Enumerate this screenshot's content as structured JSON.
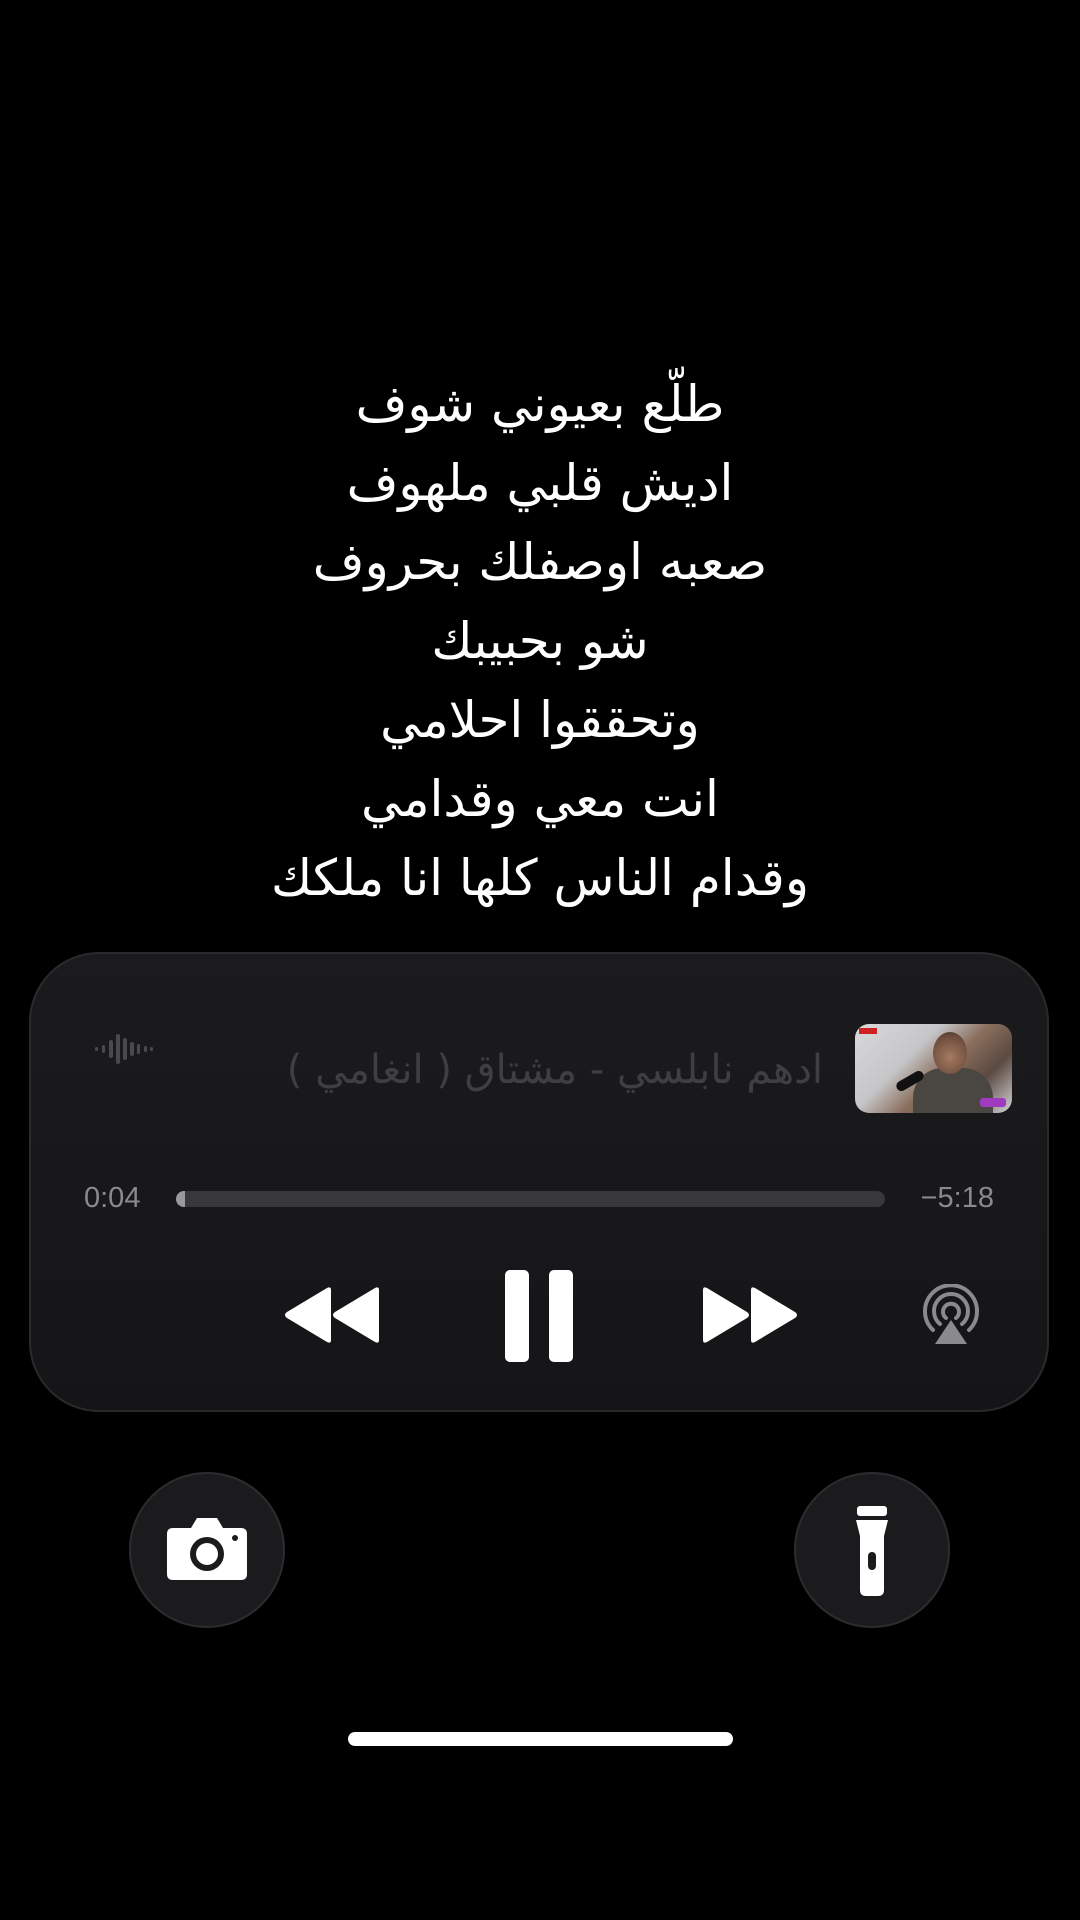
{
  "lyrics": {
    "lines": [
      "طلّع بعيوني شوف",
      "اديش قلبي ملهوف",
      "صعبه اوصفلك بحروف",
      "شو بحبيبك",
      "وتحققوا احلامي",
      "انت معي وقدامي",
      "وقدام الناس كلها انا ملكك"
    ]
  },
  "now_playing": {
    "title": "ادهم نابلسي - مشتاق ( انغامي )",
    "artwork_icon": "album-artwork",
    "waveform_icon": "waveform-icon",
    "elapsed": "0:04",
    "remaining": "−5:18",
    "progress_fraction": 0.013,
    "controls": {
      "rewind_icon": "rewind-icon",
      "pause_icon": "pause-icon",
      "forward_icon": "fast-forward-icon",
      "airplay_icon": "airplay-icon"
    }
  },
  "quick_actions": {
    "left_icon": "camera-icon",
    "right_icon": "flashlight-icon"
  },
  "colors": {
    "background": "#000000",
    "player_bg": "#1b1b1d",
    "text_primary": "#ffffff",
    "text_dim": "#3f3f42",
    "time_text": "#8a8a8e"
  }
}
